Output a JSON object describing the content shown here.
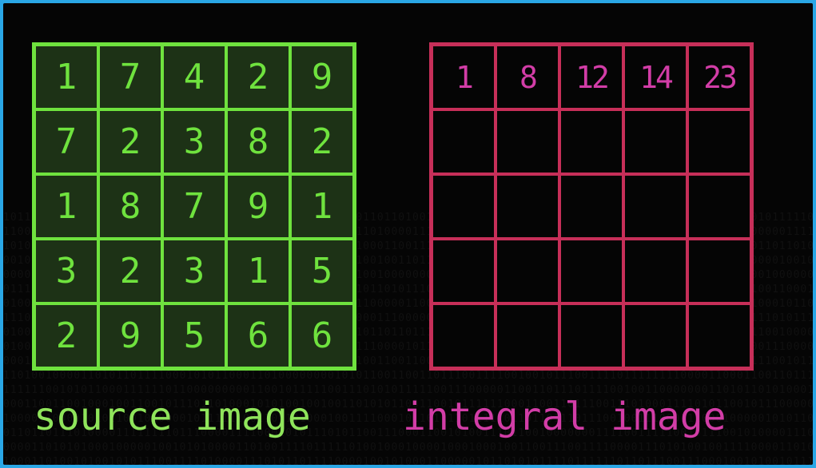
{
  "source_grid": {
    "caption": "source image",
    "rows": [
      [
        "1",
        "7",
        "4",
        "2",
        "9"
      ],
      [
        "7",
        "2",
        "3",
        "8",
        "2"
      ],
      [
        "1",
        "8",
        "7",
        "9",
        "1"
      ],
      [
        "3",
        "2",
        "3",
        "1",
        "5"
      ],
      [
        "2",
        "9",
        "5",
        "6",
        "6"
      ]
    ]
  },
  "integral_grid": {
    "caption": "integral image",
    "rows": [
      [
        "1",
        "8",
        "12",
        "14",
        "23"
      ],
      [
        "",
        "",
        "",
        "",
        ""
      ],
      [
        "",
        "",
        "",
        "",
        ""
      ],
      [
        "",
        "",
        "",
        "",
        ""
      ],
      [
        "",
        "",
        "",
        "",
        ""
      ]
    ]
  },
  "colors": {
    "frame_border": "#2aa7e6",
    "background": "#050505",
    "source_line": "#6fe23e",
    "source_fill": "#1d3216",
    "integral_line": "#c72f59",
    "integral_text": "#d23da7"
  }
}
